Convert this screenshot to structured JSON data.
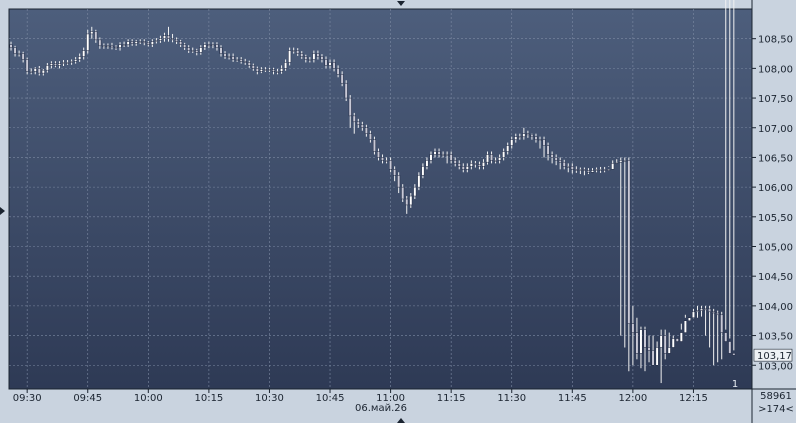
{
  "chart_data": {
    "type": "candlestick",
    "date_label": "06.май.26",
    "x_tick_labels": [
      "09:30",
      "09:45",
      "10:00",
      "10:15",
      "10:30",
      "10:45",
      "11:00",
      "11:15",
      "11:30",
      "11:45",
      "12:00",
      "12:15"
    ],
    "y_tick_labels": [
      "108,50",
      "108,00",
      "107,50",
      "107,00",
      "106,50",
      "106,00",
      "105,50",
      "105,00",
      "104,50",
      "104,00",
      "103,50",
      "103,00"
    ],
    "y_ticks": [
      108.5,
      108.0,
      107.5,
      107.0,
      106.5,
      106.0,
      105.5,
      105.0,
      104.5,
      104.0,
      103.5,
      103.0
    ],
    "ylim": [
      102.6,
      109.0
    ],
    "time_start": "09:26",
    "minutes_per_bar": 1,
    "last_price_label": "103,17",
    "last_price": 103.17,
    "volume_label": "58961",
    "bars_label": ">174<",
    "marker_label": "1",
    "grid": true,
    "colors": {
      "background_top": "#4d5e7c",
      "background_bottom": "#2e3a55",
      "grid": "#7d8aa3",
      "up_body": "#ffffff",
      "down_body": "#c9c9d6",
      "wick": "#f2f2f2",
      "panel": "#c9d3df",
      "text": "#1b2430"
    },
    "close": [
      108.35,
      108.25,
      108.25,
      108.15,
      107.95,
      107.95,
      108.0,
      107.92,
      107.97,
      108.05,
      108.08,
      108.05,
      108.08,
      108.1,
      108.1,
      108.12,
      108.15,
      108.2,
      108.3,
      108.58,
      108.62,
      108.48,
      108.38,
      108.38,
      108.38,
      108.36,
      108.35,
      108.4,
      108.4,
      108.45,
      108.42,
      108.45,
      108.45,
      108.43,
      108.4,
      108.45,
      108.47,
      108.5,
      108.55,
      108.5,
      108.48,
      108.45,
      108.4,
      108.35,
      108.3,
      108.3,
      108.27,
      108.35,
      108.4,
      108.38,
      108.4,
      108.35,
      108.25,
      108.2,
      108.2,
      108.15,
      108.15,
      108.12,
      108.1,
      108.05,
      108.0,
      107.95,
      107.98,
      107.98,
      107.98,
      107.95,
      107.95,
      108.0,
      108.1,
      108.3,
      108.3,
      108.25,
      108.2,
      108.15,
      108.15,
      108.25,
      108.2,
      108.15,
      108.05,
      108.1,
      108.0,
      107.9,
      107.75,
      107.5,
      107.2,
      107.1,
      107.05,
      107.0,
      106.9,
      106.8,
      106.6,
      106.5,
      106.45,
      106.45,
      106.3,
      106.2,
      106.0,
      105.8,
      105.7,
      105.85,
      106.0,
      106.2,
      106.35,
      106.45,
      106.55,
      106.6,
      106.55,
      106.55,
      106.55,
      106.45,
      106.4,
      106.35,
      106.3,
      106.35,
      106.4,
      106.38,
      106.35,
      106.42,
      106.55,
      106.45,
      106.45,
      106.5,
      106.6,
      106.7,
      106.8,
      106.85,
      106.85,
      106.9,
      106.88,
      106.85,
      106.8,
      106.8,
      106.7,
      106.55,
      106.5,
      106.45,
      106.42,
      106.35,
      106.35,
      106.3,
      106.28,
      106.3,
      106.28,
      106.25,
      106.28,
      106.3,
      106.3,
      106.28,
      106.3,
      106.4,
      106.42,
      106.45,
      106.45,
      103.7,
      103.55,
      103.2,
      103.6,
      103.3,
      103.25,
      103.0,
      103.3,
      103.5,
      103.2,
      103.3,
      103.45,
      103.4,
      103.55,
      103.75,
      103.8,
      103.9,
      103.92,
      103.95,
      103.95,
      103.9,
      103.88,
      103.85,
      103.55,
      103.4,
      103.2,
      103.17
    ],
    "open": [
      108.4,
      108.35,
      108.25,
      108.25,
      108.15,
      107.95,
      107.95,
      108.0,
      107.92,
      107.97,
      108.05,
      108.08,
      108.05,
      108.08,
      108.1,
      108.1,
      108.12,
      108.15,
      108.2,
      108.3,
      108.58,
      108.62,
      108.48,
      108.38,
      108.38,
      108.38,
      108.36,
      108.35,
      108.4,
      108.4,
      108.45,
      108.42,
      108.45,
      108.45,
      108.43,
      108.4,
      108.45,
      108.47,
      108.5,
      108.55,
      108.5,
      108.48,
      108.45,
      108.4,
      108.35,
      108.3,
      108.3,
      108.27,
      108.35,
      108.4,
      108.38,
      108.4,
      108.35,
      108.25,
      108.2,
      108.2,
      108.15,
      108.15,
      108.12,
      108.1,
      108.05,
      108.0,
      107.95,
      107.98,
      107.98,
      107.98,
      107.95,
      107.95,
      108.0,
      108.1,
      108.3,
      108.3,
      108.25,
      108.2,
      108.15,
      108.15,
      108.25,
      108.2,
      108.15,
      108.05,
      108.1,
      108.0,
      107.9,
      107.75,
      107.5,
      107.2,
      107.1,
      107.05,
      107.0,
      106.9,
      106.8,
      106.6,
      106.5,
      106.45,
      106.45,
      106.3,
      106.2,
      106.0,
      105.8,
      105.7,
      105.85,
      106.0,
      106.2,
      106.35,
      106.45,
      106.55,
      106.6,
      106.55,
      106.55,
      106.55,
      106.45,
      106.4,
      106.35,
      106.3,
      106.35,
      106.4,
      106.38,
      106.35,
      106.42,
      106.55,
      106.45,
      106.45,
      106.5,
      106.6,
      106.7,
      106.8,
      106.85,
      106.85,
      106.9,
      106.88,
      106.85,
      106.8,
      106.8,
      106.7,
      106.55,
      106.5,
      106.45,
      106.42,
      106.35,
      106.35,
      106.3,
      106.28,
      106.3,
      106.28,
      106.25,
      106.28,
      106.3,
      106.3,
      106.28,
      106.3,
      106.4,
      106.42,
      106.45,
      106.45,
      103.7,
      103.55,
      103.2,
      103.6,
      103.3,
      103.25,
      103.0,
      103.3,
      103.5,
      103.2,
      103.3,
      103.45,
      103.4,
      103.55,
      103.75,
      103.8,
      103.9,
      103.92,
      103.95,
      103.95,
      103.9,
      103.88,
      103.85,
      103.55,
      103.4,
      103.2
    ],
    "high": [
      108.45,
      108.38,
      108.3,
      108.28,
      108.18,
      108.0,
      108.02,
      108.04,
      107.99,
      108.09,
      108.12,
      108.12,
      108.12,
      108.14,
      108.14,
      108.15,
      108.19,
      108.25,
      108.35,
      108.65,
      108.7,
      108.65,
      108.52,
      108.42,
      108.42,
      108.43,
      108.39,
      108.44,
      108.45,
      108.49,
      108.49,
      108.48,
      108.49,
      108.49,
      108.46,
      108.49,
      108.51,
      108.55,
      108.6,
      108.7,
      108.58,
      108.52,
      108.48,
      108.43,
      108.39,
      108.35,
      108.33,
      108.39,
      108.44,
      108.45,
      108.44,
      108.44,
      108.39,
      108.29,
      108.25,
      108.25,
      108.19,
      108.19,
      108.16,
      108.13,
      108.08,
      108.03,
      108.02,
      108.02,
      108.01,
      108.01,
      107.99,
      108.05,
      108.15,
      108.35,
      108.35,
      108.34,
      108.29,
      108.23,
      108.19,
      108.3,
      108.3,
      108.24,
      108.2,
      108.15,
      108.15,
      108.05,
      107.95,
      107.8,
      107.55,
      107.25,
      107.15,
      107.1,
      107.05,
      106.95,
      106.85,
      106.65,
      106.55,
      106.5,
      106.5,
      106.35,
      106.25,
      106.05,
      105.85,
      105.9,
      106.05,
      106.25,
      106.4,
      106.5,
      106.6,
      106.65,
      106.65,
      106.6,
      106.6,
      106.6,
      106.5,
      106.45,
      106.4,
      106.4,
      106.45,
      106.44,
      106.43,
      106.47,
      106.6,
      106.6,
      106.5,
      106.55,
      106.65,
      106.75,
      106.85,
      106.9,
      106.9,
      107.0,
      106.95,
      106.9,
      106.9,
      106.85,
      106.85,
      106.75,
      106.6,
      106.55,
      106.5,
      106.46,
      106.4,
      106.4,
      106.35,
      106.33,
      106.33,
      106.32,
      106.32,
      106.33,
      106.34,
      106.34,
      106.34,
      106.45,
      106.47,
      106.5,
      106.5,
      106.5,
      104.0,
      103.8,
      103.65,
      103.65,
      103.5,
      103.5,
      103.4,
      103.6,
      103.6,
      103.55,
      103.5,
      103.5,
      103.6,
      103.8,
      103.85,
      103.95,
      104.0,
      104.0,
      104.0,
      104.0,
      103.95,
      103.92,
      103.9,
      103.6,
      103.45,
      103.25
    ],
    "low": [
      108.3,
      108.2,
      108.2,
      108.1,
      107.9,
      107.9,
      107.9,
      107.88,
      107.88,
      107.93,
      108.0,
      108.02,
      108.0,
      108.04,
      108.06,
      108.06,
      108.08,
      108.11,
      108.15,
      108.25,
      108.5,
      108.43,
      108.33,
      108.33,
      108.33,
      108.32,
      108.31,
      108.3,
      108.36,
      108.36,
      108.38,
      108.38,
      108.41,
      108.39,
      108.37,
      108.36,
      108.42,
      108.43,
      108.45,
      108.45,
      108.44,
      108.41,
      108.36,
      108.31,
      108.26,
      108.26,
      108.22,
      108.23,
      108.31,
      108.34,
      108.34,
      108.3,
      108.2,
      108.16,
      108.15,
      108.11,
      108.11,
      108.08,
      108.06,
      108.01,
      107.96,
      107.9,
      107.92,
      107.94,
      107.94,
      107.9,
      107.9,
      107.91,
      107.96,
      108.05,
      108.25,
      108.21,
      108.16,
      108.1,
      108.1,
      108.1,
      108.15,
      108.1,
      108.0,
      108.0,
      107.95,
      107.85,
      107.7,
      107.45,
      107.0,
      106.9,
      107.0,
      106.95,
      106.85,
      106.75,
      106.55,
      106.45,
      106.4,
      106.4,
      106.25,
      106.1,
      105.9,
      105.75,
      105.55,
      105.65,
      105.8,
      105.95,
      106.15,
      106.3,
      106.4,
      106.5,
      106.5,
      106.5,
      106.4,
      106.4,
      106.35,
      106.3,
      106.25,
      106.25,
      106.3,
      106.33,
      106.3,
      106.3,
      106.38,
      106.4,
      106.4,
      106.4,
      106.45,
      106.55,
      106.65,
      106.75,
      106.8,
      106.8,
      106.83,
      106.8,
      106.75,
      106.65,
      106.5,
      106.45,
      106.4,
      106.37,
      106.3,
      106.3,
      106.25,
      106.23,
      106.24,
      106.22,
      106.2,
      106.22,
      106.25,
      106.25,
      106.24,
      106.25,
      106.35,
      106.38,
      106.4,
      103.5,
      103.3,
      102.9,
      103.0,
      103.1,
      102.95,
      102.9,
      103.05,
      103.2,
      103.1,
      102.7,
      103.1,
      103.3,
      103.35,
      103.5,
      103.7,
      103.85,
      103.85,
      103.8,
      103.8,
      103.82,
      103.5,
      103.3,
      103.0,
      103.05,
      103.1
    ]
  }
}
